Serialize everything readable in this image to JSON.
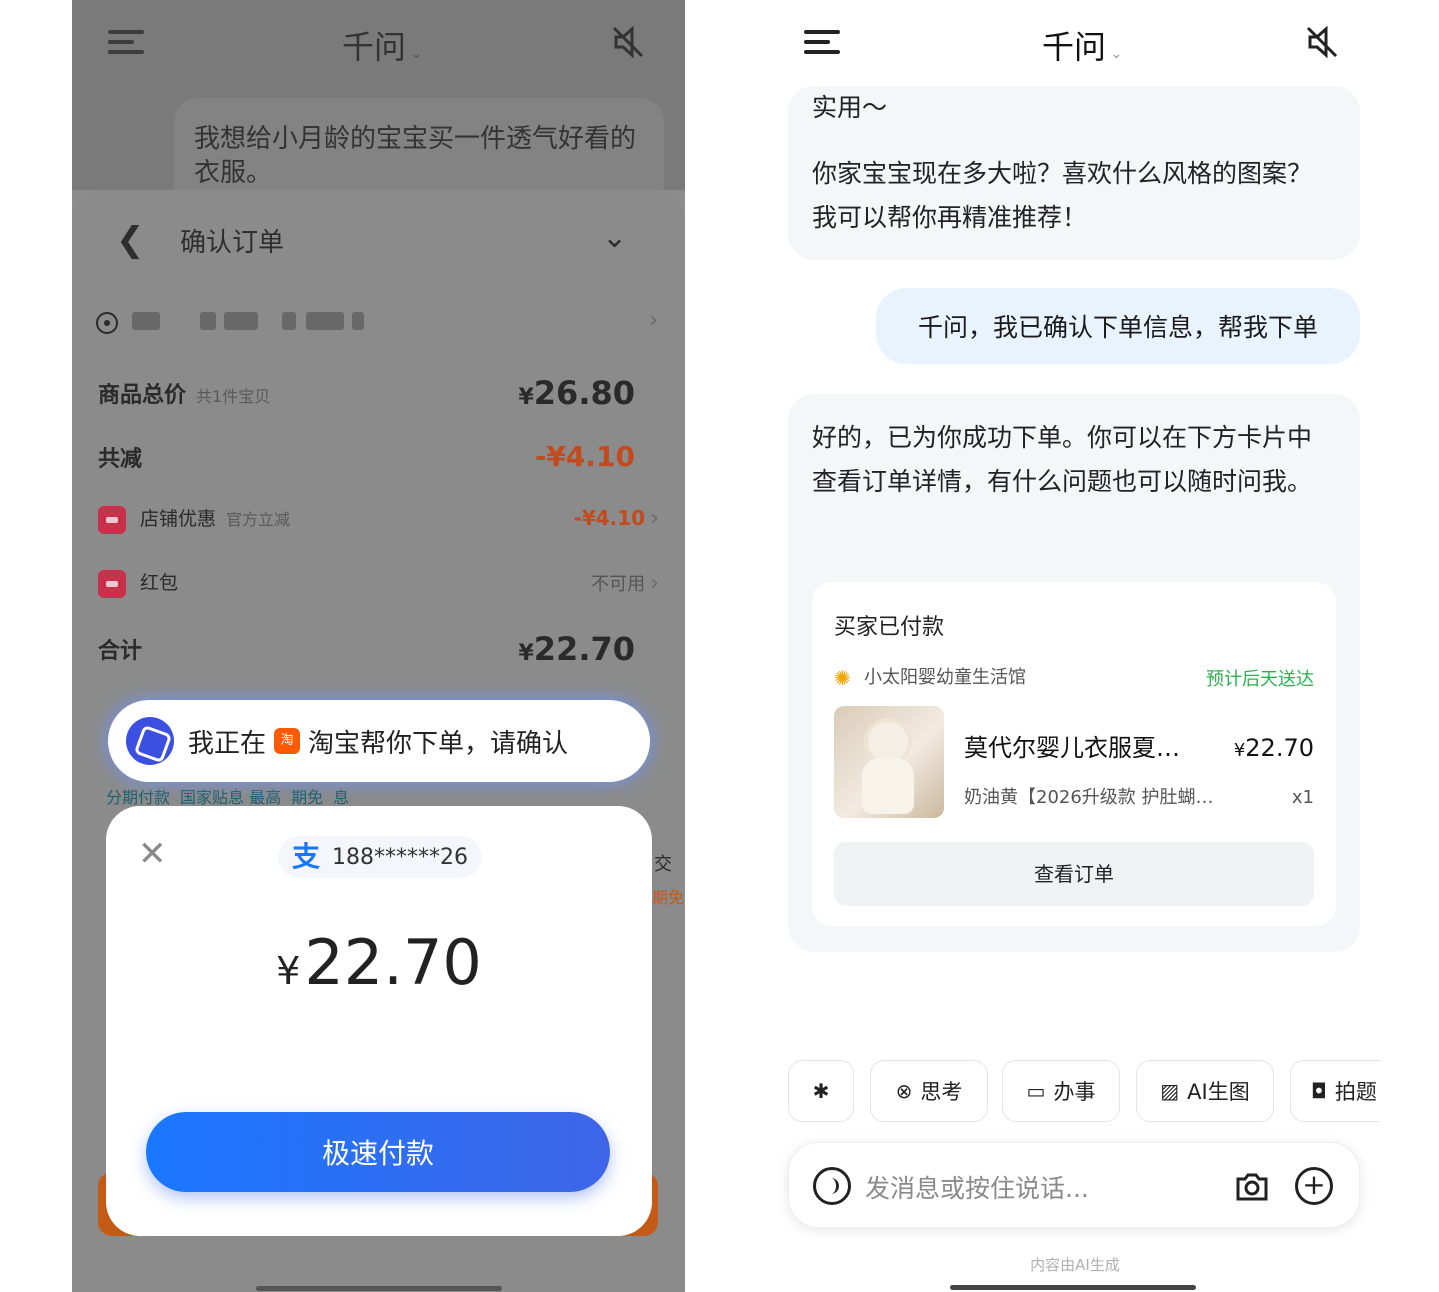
{
  "left": {
    "app_title": "千问",
    "user_message": "我想给小月龄的宝宝买一件透气好看的衣服。",
    "sheet": {
      "title": "确认订单",
      "rows": [
        {
          "label": "商品总价",
          "sub": "共1件宝贝",
          "value_symbol": "¥",
          "value": "26.80"
        },
        {
          "label": "共减",
          "value": "-¥4.10"
        },
        {
          "label": "店铺优惠",
          "sub": "官方立减",
          "value": "-¥4.10"
        },
        {
          "label": "红包",
          "value": "不可用"
        },
        {
          "label": "合计",
          "value_symbol": "¥",
          "value": "22.70"
        }
      ],
      "install_label": "分期付款",
      "install_sub": "国家贴息 最高",
      "install_sub2": "期免",
      "install_sub3": "息"
    },
    "agent_pill": {
      "prefix": "我正在",
      "app_badge": "淘",
      "suffix": "淘宝帮你下单，请确认"
    },
    "payment": {
      "account": "188******26",
      "amount_symbol": "¥",
      "amount": "22.70",
      "button": "极速付款"
    },
    "peek": {
      "trade": "交",
      "free": "期免"
    }
  },
  "right": {
    "app_title": "千问",
    "ai_msg_1_top": "实用～",
    "ai_msg_1_line1": "你家宝宝现在多大啦？喜欢什么风格的图案？",
    "ai_msg_1_line2": "我可以帮你再精准推荐！",
    "user_msg": "千问，我已确认下单信息，帮我下单",
    "ai_msg_2": "好的，已为你成功下单。你可以在下方卡片中查看订单详情，有什么问题也可以随时问我。",
    "order_card": {
      "status": "买家已付款",
      "shop": "小太阳婴幼童生活馆",
      "eta": "预计后天送达",
      "product_name": "莫代尔婴儿衣服夏…",
      "price_symbol": "¥",
      "price": "22.70",
      "spec": "奶油黄【2026升级款 护肚蝴…",
      "qty": "x1",
      "button": "查看订单"
    },
    "tools": [
      {
        "icon": "sparkle-icon",
        "label": ""
      },
      {
        "icon": "think-icon",
        "label": "思考"
      },
      {
        "icon": "task-icon",
        "label": "办事"
      },
      {
        "icon": "image-gen-icon",
        "label": "AI生图"
      },
      {
        "icon": "photo-question-icon",
        "label": "拍题"
      }
    ],
    "input_placeholder": "发消息或按住说话...",
    "footer": "内容由AI生成"
  },
  "colors": {
    "accent_blue": "#1a78ff",
    "user_bubble": "#e9f3fe",
    "ai_bubble": "#f5f6f8",
    "eta_green": "#2bb14f",
    "discount_red": "#c34a1c",
    "taobao_orange": "#ff5a00"
  }
}
